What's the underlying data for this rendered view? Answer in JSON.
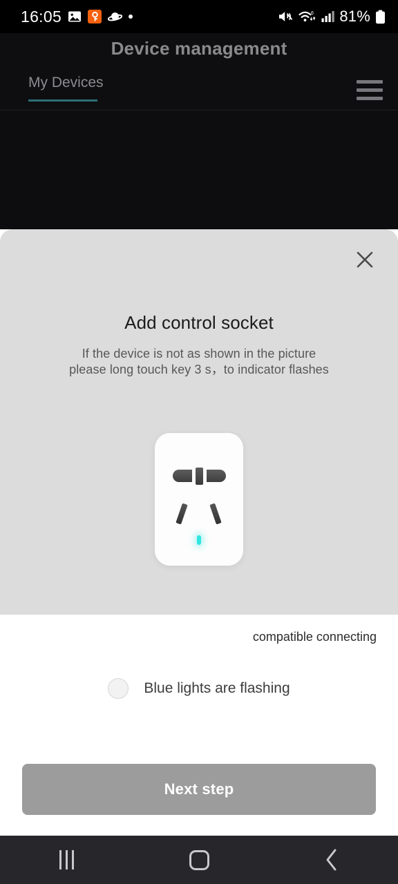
{
  "status_bar": {
    "clock": "16:05",
    "battery_percent": "81%",
    "left_icons": [
      "photos-icon",
      "key-badge-icon",
      "saturn-icon",
      "dot-icon"
    ],
    "right_icons": [
      "mute-icon",
      "wifi-6-icon",
      "cellular-signal-icon",
      "battery-icon"
    ],
    "background": "#000000"
  },
  "header": {
    "title": "Device management",
    "tabs": [
      {
        "label": "My Devices",
        "active": true
      }
    ],
    "menu_icon": "hamburger-menu-icon",
    "active_tab_color": "#2d7078",
    "background": "#0e0e10"
  },
  "sheet": {
    "close_icon": "close-x-icon",
    "title": "Add control socket",
    "subtitle_line_1": "If the device is not as shown in the picture",
    "subtitle_line_2": "please long touch key 3 s，to indicator flashes",
    "panel_color": "#dcdcdc",
    "device": {
      "name": "control-socket",
      "body_color": "#fdfdfd",
      "led_color": "#2fe6e0",
      "holes": [
        "socket-hole-left",
        "socket-hole-center",
        "socket-hole-right",
        "socket-hole-bottom-left",
        "socket-hole-bottom-right"
      ]
    }
  },
  "footer": {
    "compatible_text": "compatible connecting",
    "status_label": "Blue lights are flashing",
    "status_radio_checked": false,
    "next_button_label": "Next step",
    "next_button_color": "#9c9c9c",
    "next_button_enabled": false
  },
  "nav_bar": {
    "buttons": [
      "recents-icon",
      "home-icon",
      "back-icon"
    ],
    "background": "#26262b"
  }
}
